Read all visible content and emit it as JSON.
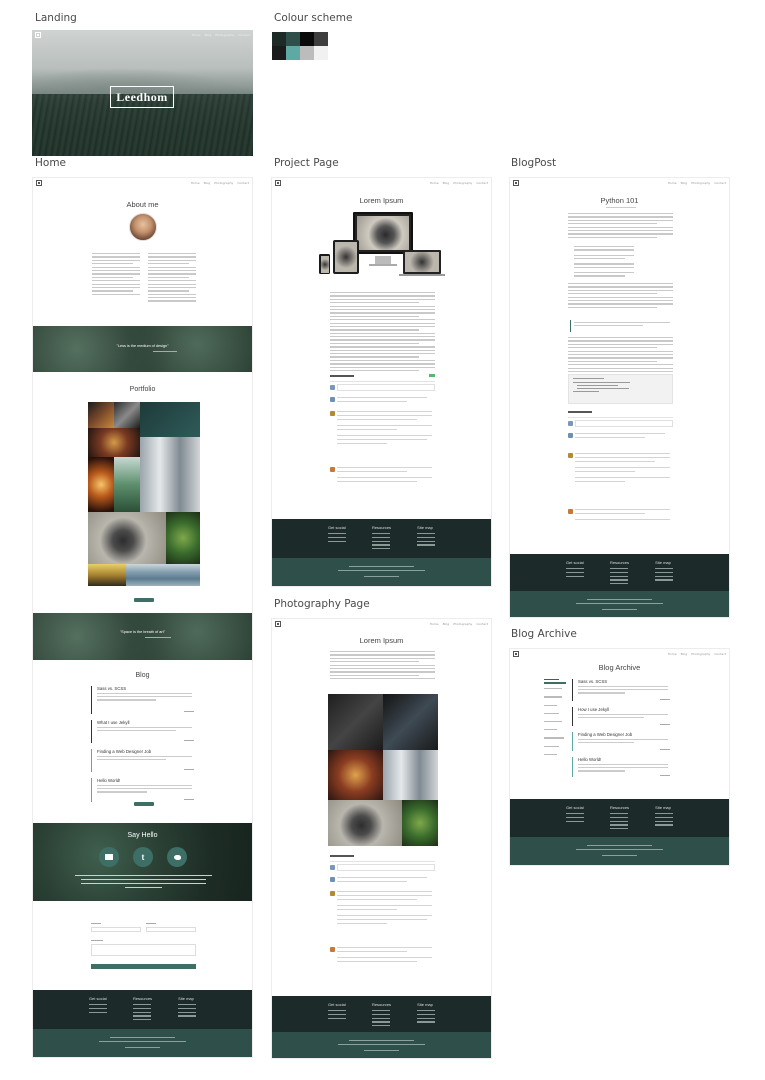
{
  "sections": {
    "landing": "Landing",
    "colour_scheme": "Colour scheme",
    "home": "Home",
    "project_page": "Project Page",
    "blog_post": "BlogPost",
    "photography_page": "Photography Page",
    "blog_archive": "Blog Archive"
  },
  "nav": {
    "links": [
      "Home",
      "Blog",
      "Photography",
      "Contact"
    ]
  },
  "landing": {
    "brand": "Leedhom"
  },
  "colour_scheme": {
    "swatches": [
      "#1e2a28",
      "#2f4f4a",
      "#0a0a0a",
      "#1b1b1b",
      "#3e3e3e",
      "#5fa9a4",
      "#3d6f66",
      "#bcbcbc",
      "#f1f1f1"
    ]
  },
  "home": {
    "about_title": "About me",
    "quote1": "\"Less is the medium of design\"",
    "portfolio_title": "Portfolio",
    "quote2": "\"Space is the breath of art\"",
    "blog_title": "Blog",
    "blog_items": [
      "Sass vs. SCSS",
      "What I use Jekyll",
      "Finding a Web Designer Job",
      "Hello World!"
    ],
    "say_hello": "Say Hello",
    "social_icons": [
      "envelope-icon",
      "tumblr-icon",
      "twitter-icon"
    ]
  },
  "project": {
    "title": "Lorem Ipsum"
  },
  "blogpost": {
    "title": "Python 101"
  },
  "photography": {
    "title": "Lorem Ipsum"
  },
  "archive": {
    "title": "Blog Archive",
    "items": [
      "Sass vs. SCSS",
      "How I use Jekyll",
      "Finding a Web Designer Job",
      "Hello World!"
    ]
  },
  "footer": {
    "columns": [
      "Get social",
      "Resources",
      "Site map"
    ]
  },
  "colors": {
    "accent": "#3d6f66",
    "dark": "#1c2b29",
    "footer_bottom": "#2f4f4a"
  }
}
